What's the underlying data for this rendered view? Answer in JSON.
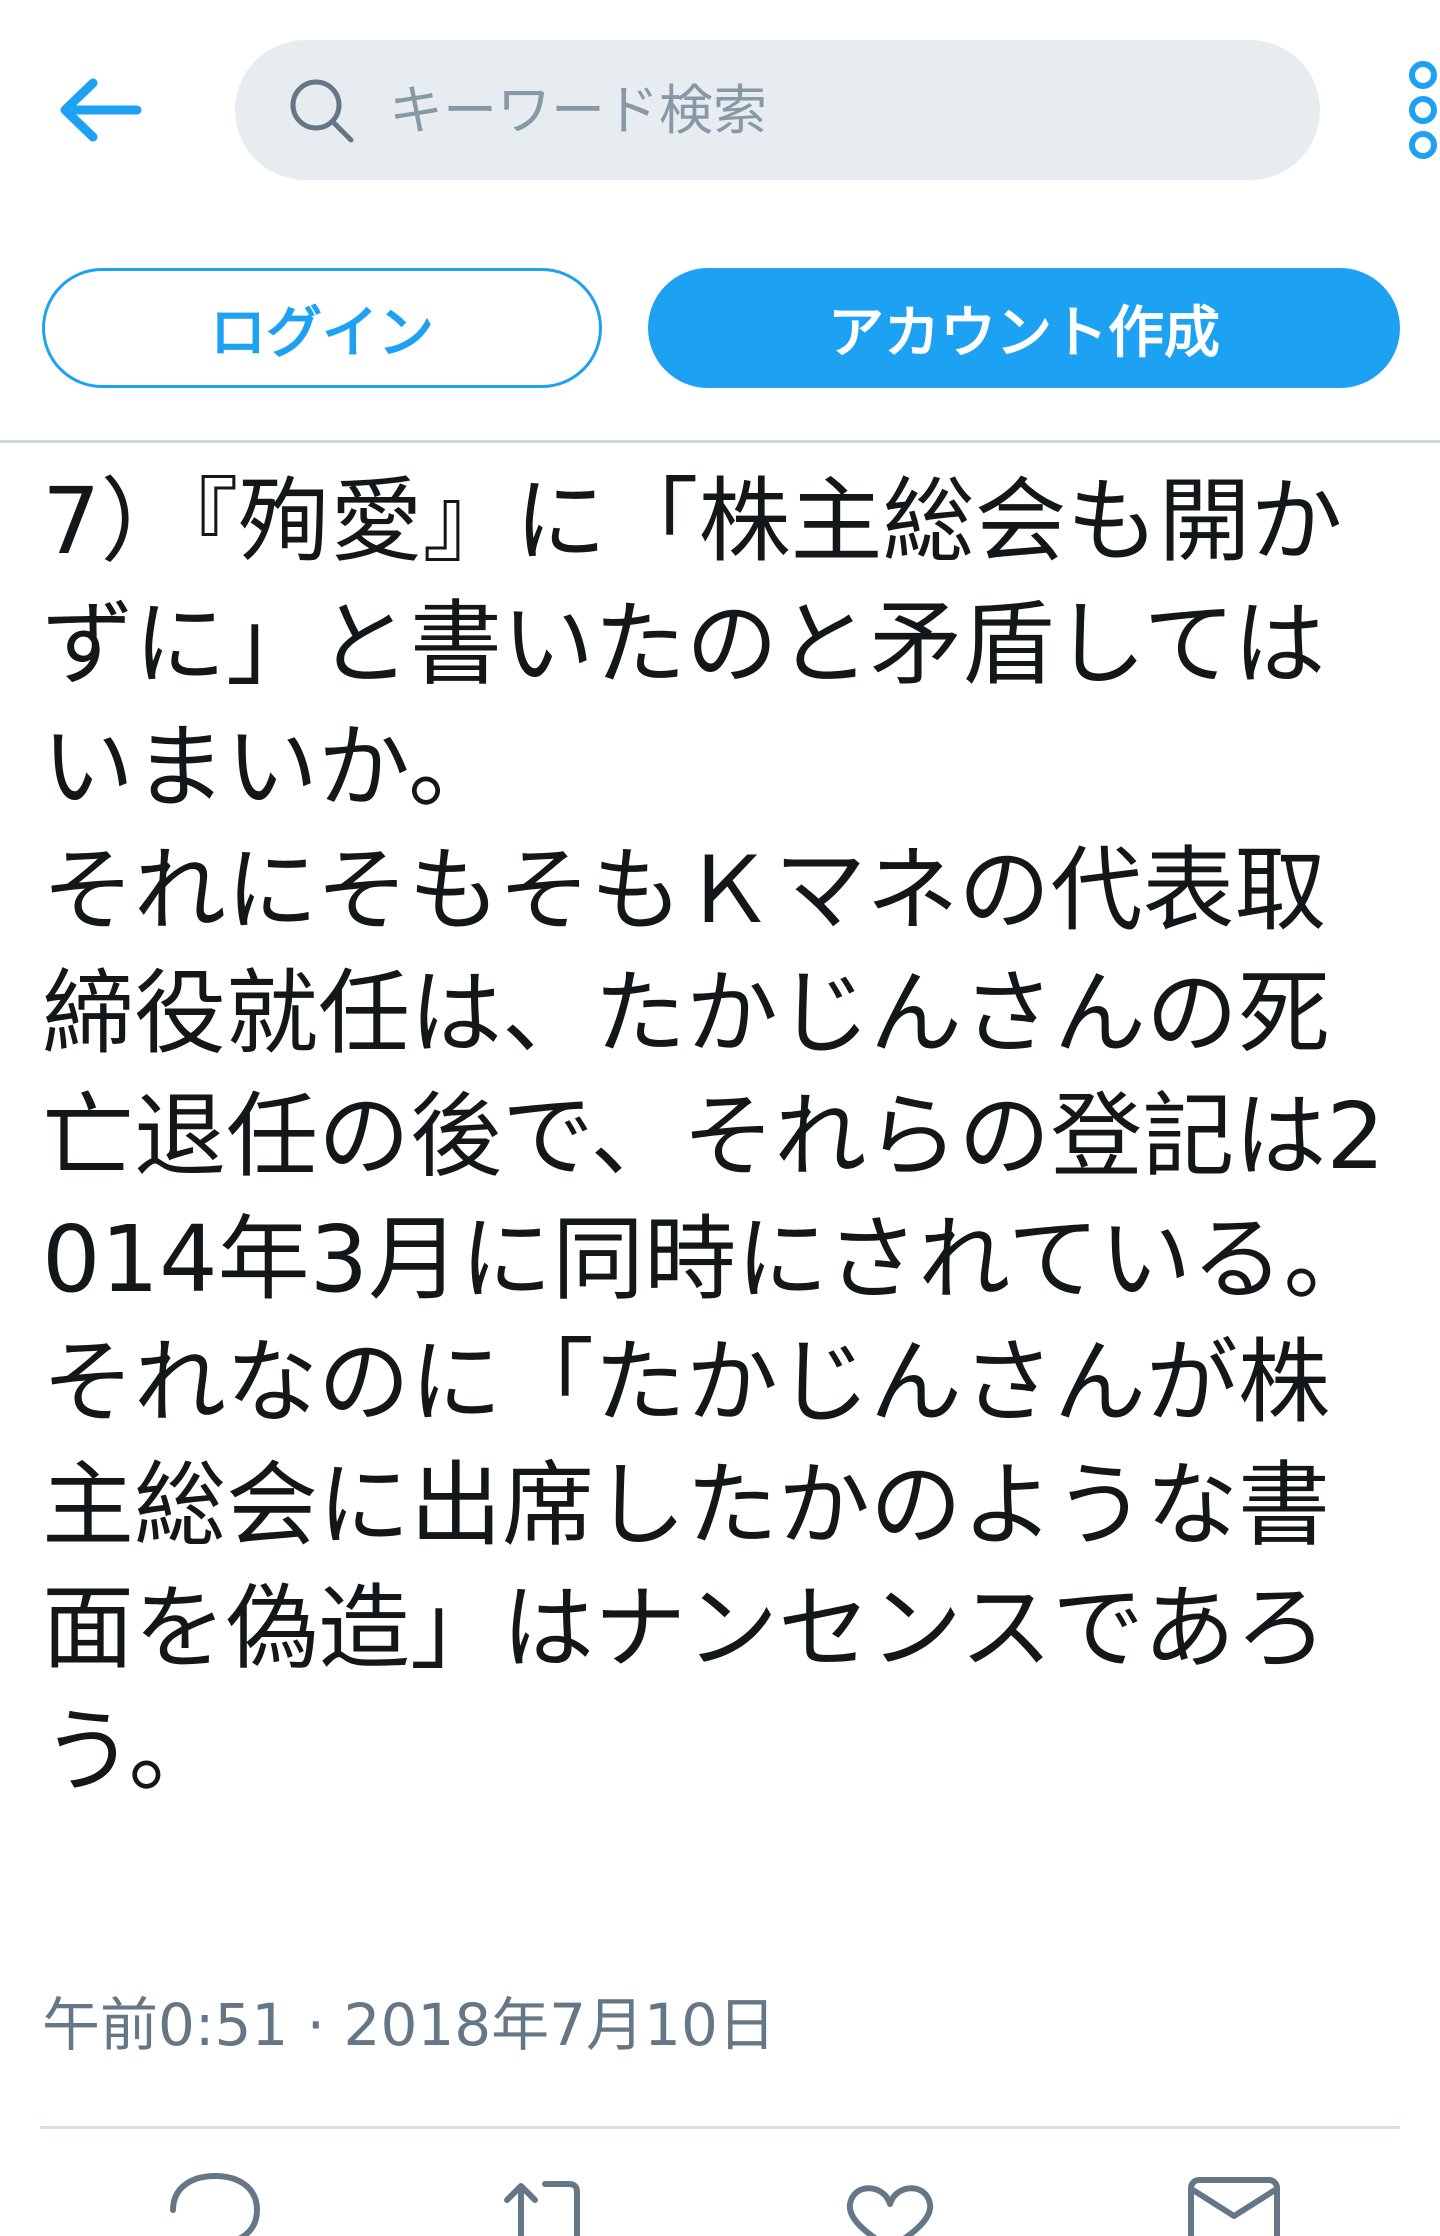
{
  "header": {
    "search": {
      "placeholder": "キーワード検索",
      "value": ""
    }
  },
  "auth": {
    "login_label": "ログイン",
    "signup_label": "アカウント作成"
  },
  "tweet": {
    "text": "7）『殉愛』に「株主総会も開かずに」と書いたのと矛盾してはいまいか。\nそれにそもそもＫマネの代表取締役就任は、たかじんさんの死亡退任の後で、それらの登記は2014年3月に同時にされている。\nそれなのに「たかじんさんが株主総会に出席したかのような書面を偽造」はナンセンスであろう。",
    "timestamp": "午前0:51 · 2018年7月10日"
  },
  "icons": {
    "back": "back-arrow-icon",
    "search": "search-icon",
    "more": "more-vertical-icon",
    "reply": "reply-icon",
    "retweet": "retweet-icon",
    "like": "heart-icon",
    "message": "envelope-icon"
  },
  "colors": {
    "accent": "#1da1f2",
    "search_bg": "#e6ecf0",
    "text": "#14171a",
    "muted": "#657786"
  }
}
